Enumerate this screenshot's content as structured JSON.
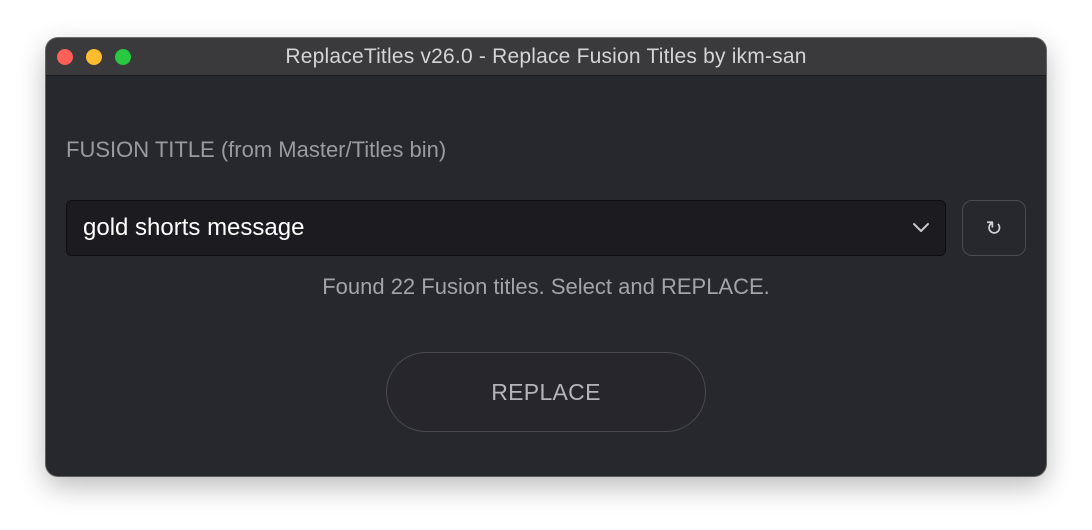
{
  "window": {
    "title": "ReplaceTitles v26.0 - Replace Fusion Titles by ikm-san",
    "traffic_lights": {
      "close_color": "#fe5f57",
      "minimize_color": "#febc2e",
      "zoom_color": "#28c840"
    }
  },
  "form": {
    "section_label": "FUSION TITLE (from Master/Titles bin)",
    "title_select": {
      "selected_value": "gold shorts message",
      "icon": "chevron-down-icon"
    },
    "refresh_button": {
      "glyph": "↻",
      "icon": "refresh-icon"
    },
    "status_text": "Found 22 Fusion titles. Select and REPLACE.",
    "replace_button_label": "REPLACE"
  },
  "colors": {
    "window_background": "#27272e",
    "titlebar_background": "#3a3a3c",
    "select_background": "#1c1c20"
  }
}
